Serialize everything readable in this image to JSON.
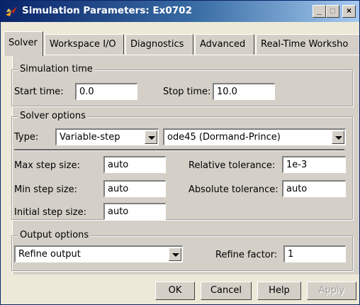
{
  "window": {
    "title": "Simulation Parameters: Ex0702"
  },
  "titlebar_buttons": {
    "minimize": "_",
    "maximize": "□",
    "close": "×"
  },
  "tabs": [
    {
      "label": "Solver",
      "active": true
    },
    {
      "label": "Workspace I/O",
      "active": false
    },
    {
      "label": "Diagnostics",
      "active": false
    },
    {
      "label": "Advanced",
      "active": false
    },
    {
      "label": "Real-Time Worksho",
      "active": false
    }
  ],
  "simulation_time": {
    "title": "Simulation time",
    "start_label": "Start time:",
    "start_value": "0.0",
    "stop_label": "Stop time:",
    "stop_value": "10.0"
  },
  "solver_options": {
    "title": "Solver options",
    "type_label": "Type:",
    "type_value": "Variable-step",
    "solver_value": "ode45 (Dormand-Prince)",
    "max_step_label": "Max step size:",
    "max_step_value": "auto",
    "min_step_label": "Min step size:",
    "min_step_value": "auto",
    "initial_step_label": "Initial step size:",
    "initial_step_value": "auto",
    "rel_tol_label": "Relative tolerance:",
    "rel_tol_value": "1e-3",
    "abs_tol_label": "Absolute tolerance:",
    "abs_tol_value": "auto"
  },
  "output_options": {
    "title": "Output options",
    "output_value": "Refine output",
    "refine_label": "Refine factor:",
    "refine_value": "1"
  },
  "buttons": {
    "ok": "OK",
    "cancel": "Cancel",
    "help": "Help",
    "apply": "Apply"
  },
  "colors": {
    "titlebar": "#0a246a",
    "face": "#d4d0c8"
  },
  "icons": {
    "app": "simulink-arrow-icon"
  }
}
